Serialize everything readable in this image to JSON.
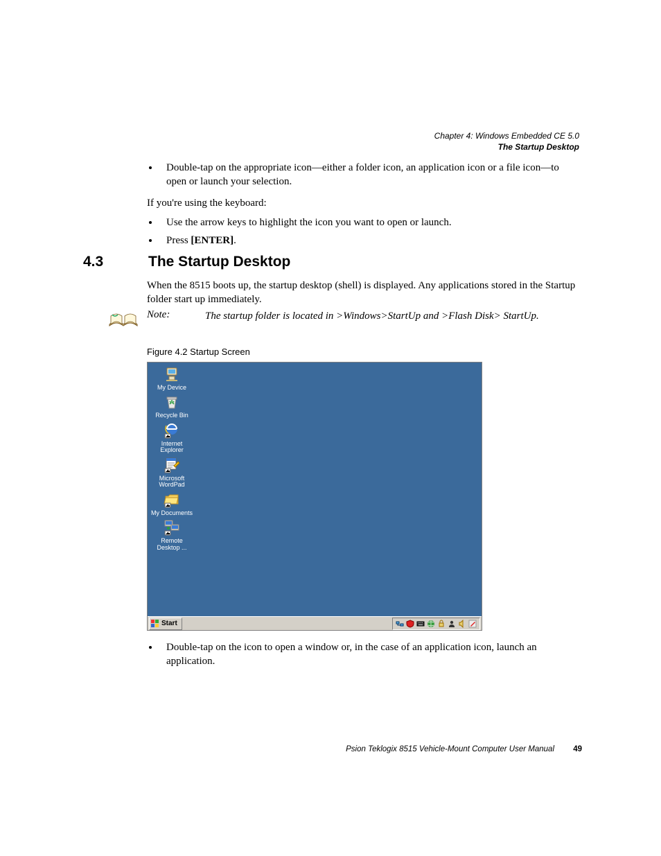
{
  "header": {
    "chapter": "Chapter 4: Windows Embedded CE 5.0",
    "section": "The Startup Desktop"
  },
  "intro": {
    "bullet1": "Double-tap on the appropriate icon—either a folder icon, an application icon or a file icon—to open or launch your selection.",
    "keyboard_lead": "If you're using the keyboard:",
    "bullet2": "Use the arrow keys to highlight the icon you want to open or launch.",
    "bullet3_pre": "Press ",
    "bullet3_key": "[ENTER]",
    "bullet3_post": "."
  },
  "section43": {
    "number": "4.3",
    "title": "The Startup Desktop",
    "para": "When the 8515 boots up, the startup desktop (shell) is displayed. Any applications stored in the Startup folder start up immediately."
  },
  "note": {
    "label": "Note:",
    "text": "The startup folder is located in >Windows>StartUp and >Flash Disk> StartUp."
  },
  "figure": {
    "caption": "Figure 4.2  Startup Screen"
  },
  "desktop": {
    "icons": [
      {
        "name": "my-device",
        "label": "My Device"
      },
      {
        "name": "recycle-bin",
        "label": "Recycle Bin"
      },
      {
        "name": "internet-explorer",
        "label": "Internet Explorer"
      },
      {
        "name": "microsoft-wordpad",
        "label": "Microsoft WordPad"
      },
      {
        "name": "my-documents",
        "label": "My Documents"
      },
      {
        "name": "remote-desktop",
        "label": "Remote Desktop ..."
      }
    ],
    "start_label": "Start",
    "tray_icons": [
      "network",
      "shield",
      "keyboard",
      "world",
      "lock",
      "user",
      "volume",
      "stylus"
    ]
  },
  "after": {
    "bullet": "Double-tap on the icon to open a window or, in the case of an application icon, launch an application."
  },
  "footer": {
    "text": "Psion Teklogix 8515 Vehicle-Mount Computer User Manual",
    "page": "49"
  }
}
